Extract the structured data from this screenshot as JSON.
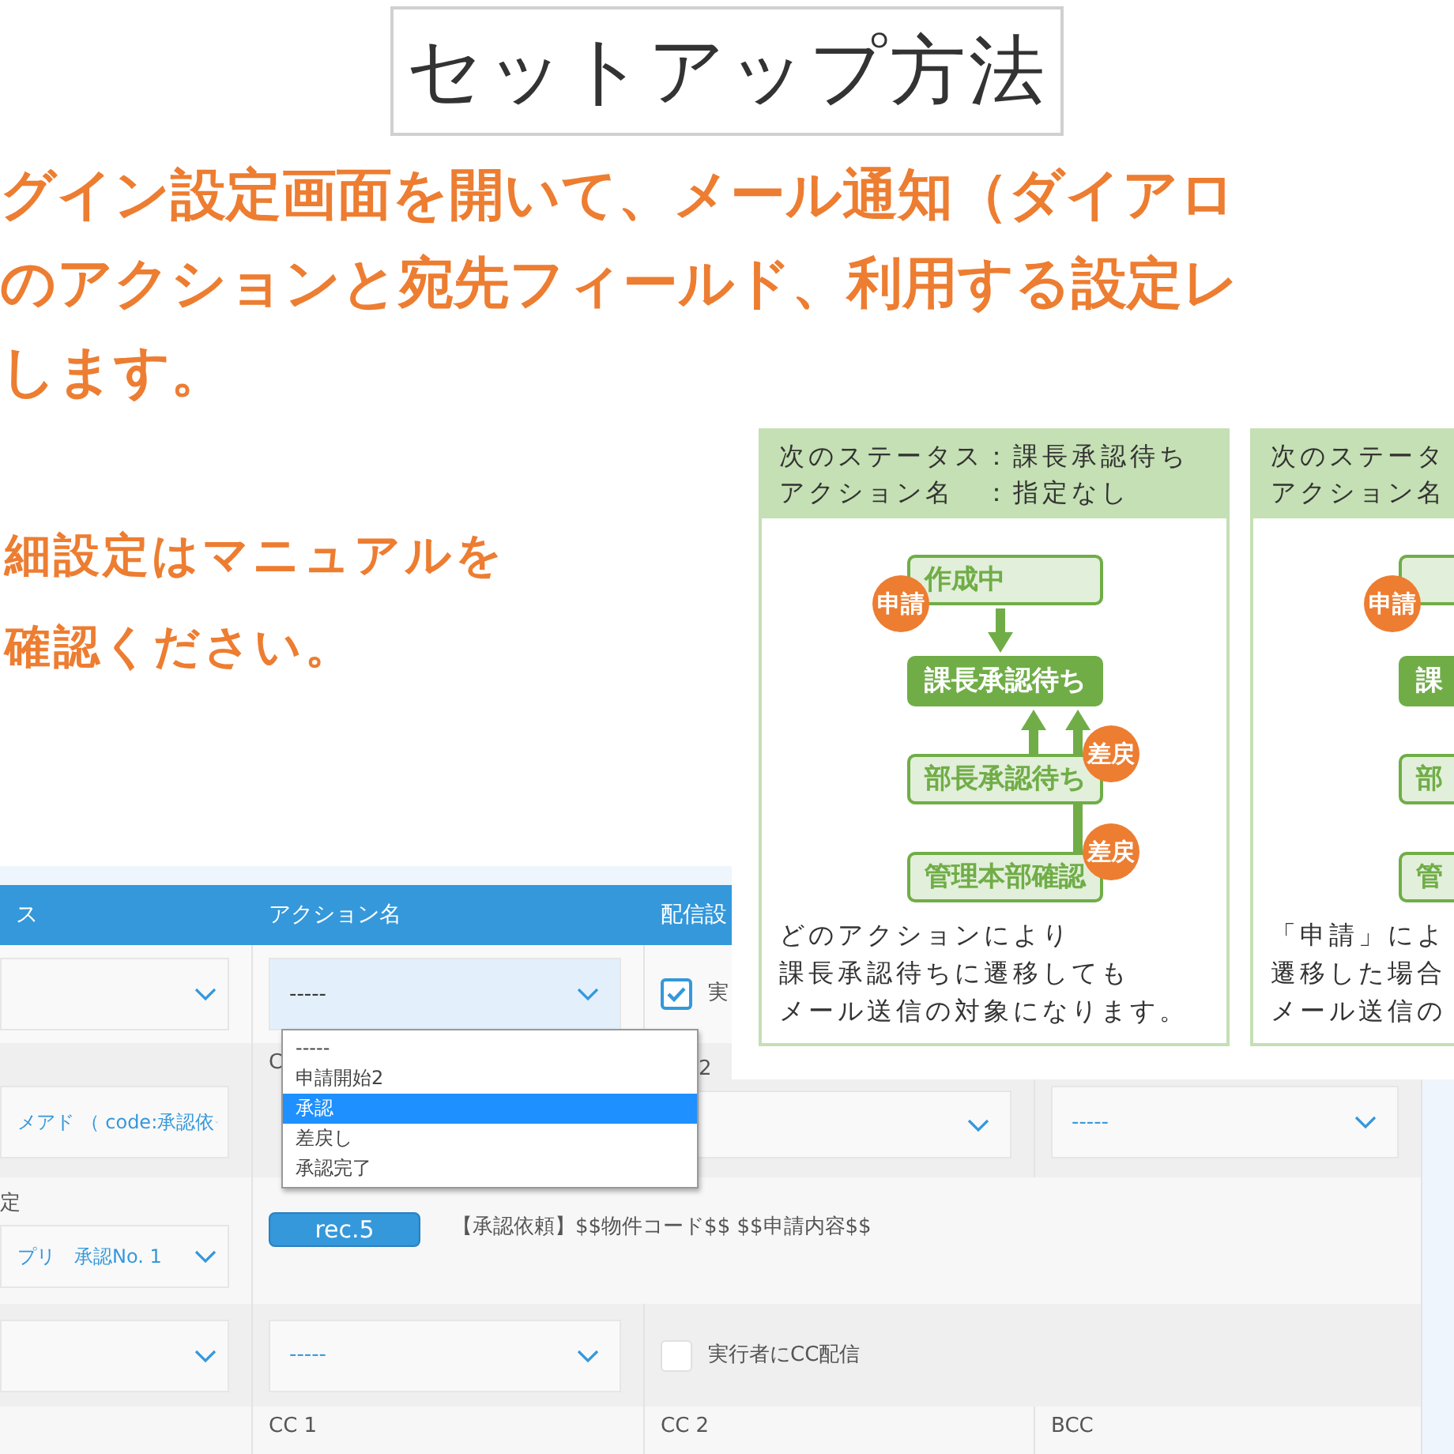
{
  "title": "セットアップ方法",
  "intro_lines": [
    "グイン設定画面を開いて、メール通知（ダイアロ",
    "のアクションと宛先フィールド、利用する設定レ",
    "します。"
  ],
  "note_lines": [
    "細設定はマニュアルを",
    "確認ください。"
  ],
  "settings_screen": {
    "columns": [
      "ス",
      "アクション名",
      "配信設"
    ],
    "rows": [
      {
        "cells": [
          {
            "kind": "select"
          },
          {
            "kind": "select",
            "value": "-----",
            "focused": true
          },
          {
            "kind": "checkbox",
            "checked": true,
            "label": "実"
          }
        ]
      },
      {
        "cells": [
          {
            "kind": "select",
            "value": "メアド （ code:承認依"
          },
          {
            "kind": "text",
            "label": "C"
          },
          {
            "kind": "select",
            "label": "2"
          },
          {
            "kind": "select",
            "value": "-----"
          }
        ]
      },
      {
        "cells": [
          {
            "kind": "select",
            "label": "定",
            "value": "プリ　承認No. 1"
          },
          {
            "kind": "template",
            "tag": "rec.5",
            "text": "【承認依頼】$$物件コード$$ $$申請内容$$"
          }
        ]
      },
      {
        "cells": [
          {
            "kind": "select"
          },
          {
            "kind": "select",
            "value": "-----"
          },
          {
            "kind": "checkbox",
            "checked": false,
            "label": "実行者にCC配信"
          }
        ]
      },
      {
        "cells": [
          {
            "kind": "empty"
          },
          {
            "kind": "text",
            "label": "CC 1"
          },
          {
            "kind": "text",
            "label": "CC 2"
          },
          {
            "kind": "text",
            "label": "BCC"
          }
        ]
      }
    ],
    "dropdown": {
      "options": [
        {
          "label": "-----",
          "selected": false
        },
        {
          "label": "申請開始2",
          "selected": false
        },
        {
          "label": "承認",
          "selected": true
        },
        {
          "label": "差戻し",
          "selected": false
        },
        {
          "label": "承認完了",
          "selected": false
        }
      ]
    }
  },
  "flow_cards": [
    {
      "header_lines": [
        "次のステータス：課長承認待ち",
        "アクション名　：指定なし"
      ],
      "nodes": [
        {
          "label": "作成中",
          "current": false,
          "badge": {
            "text": "申請",
            "kind": "forward"
          }
        },
        {
          "label": "課長承認待ち",
          "current": true
        },
        {
          "label": "部長承認待ち",
          "current": false,
          "badge": {
            "text": "差戻",
            "kind": "back"
          }
        },
        {
          "label": "管理本部確認",
          "current": false,
          "badge": {
            "text": "差戻",
            "kind": "back"
          }
        }
      ],
      "arrows": [
        {
          "kind": "down"
        },
        {
          "kind": "up"
        },
        {
          "kind": "up_long"
        }
      ],
      "caption_lines": [
        "どのアクションにより",
        "課長承認待ちに遷移しても",
        "メール送信の対象になります。"
      ]
    },
    {
      "header_lines": [
        "次のステータ",
        "アクション名"
      ],
      "nodes": [
        {
          "current": false,
          "badge": {
            "text": "申請",
            "kind": "forward"
          }
        },
        {
          "label": "課",
          "current": true
        },
        {
          "label": "部",
          "current": false
        },
        {
          "label": "管",
          "current": false
        }
      ],
      "caption_lines": [
        "「申請」によ",
        "遷移した場合",
        "メール送信の"
      ]
    }
  ]
}
